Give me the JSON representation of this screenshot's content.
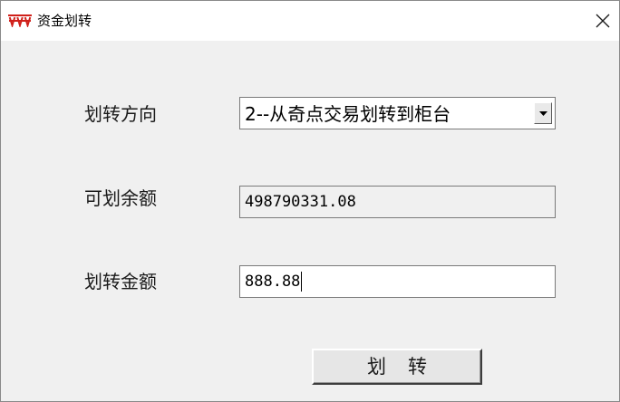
{
  "window": {
    "title": "资金划转",
    "icon": "app-logo-icon",
    "close_symbol": "✕"
  },
  "form": {
    "direction_label": "划转方向",
    "direction_value": "2--从奇点交易划转到柜台",
    "available_label": "可划余额",
    "available_value": "498790331.08",
    "amount_label": "划转金额",
    "amount_value": "888.88"
  },
  "actions": {
    "transfer_label": "划转"
  },
  "colors": {
    "titlebar": "#ffffff",
    "window_bg": "#f0f0f0",
    "icon_red": "#d0201a"
  }
}
